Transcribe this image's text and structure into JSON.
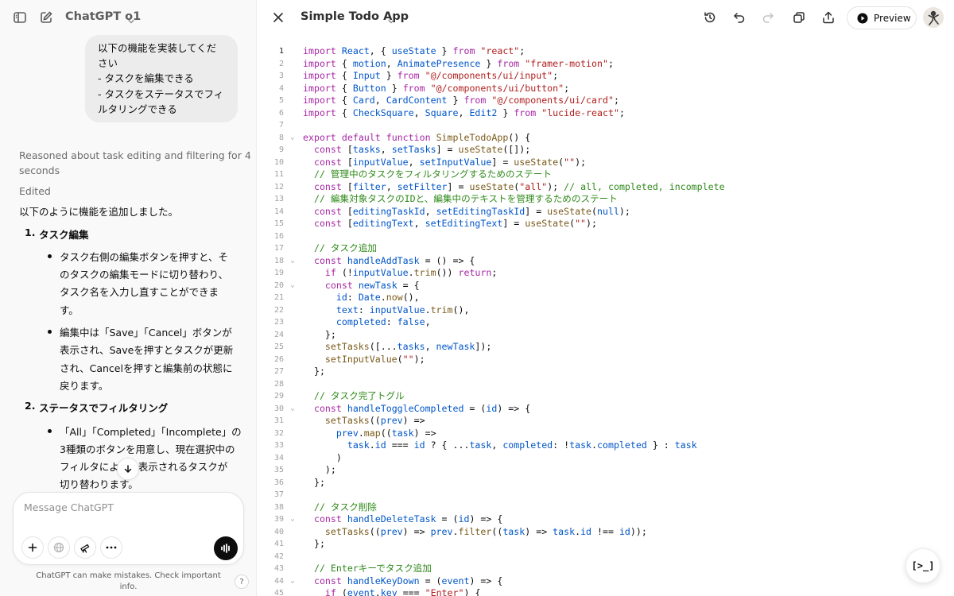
{
  "chat": {
    "model_name": "ChatGPT o1",
    "user_message": [
      "以下の機能を実装してくだ",
      "さい",
      "- タスクを編集できる",
      "- タスクをステータスでフィ",
      "ルタリングできる"
    ],
    "reasoning": [
      "Reasoned about task editing and filtering for 4",
      "seconds"
    ],
    "edited_label": "Edited",
    "intro": "以下のように機能を追加しました。",
    "sections": [
      {
        "number": "1.",
        "title": "タスク編集",
        "bullets": [
          [
            "タスク右側の編集ボタンを押すと、そ",
            "のタスクの編集モードに切り替わり、",
            "タスク名を入力し直すことができま",
            "す。"
          ],
          [
            "編集中は「Save」「Cancel」ボタンが",
            "表示され、Saveを押すとタスクが更新",
            "され、Cancelを押すと編集前の状態に",
            "戻ります。"
          ]
        ]
      },
      {
        "number": "2.",
        "title": "ステータスでフィルタリング",
        "bullets": [
          [
            "「All」「Completed」「Incomplete」の",
            "3種類のボタンを用意し、現在選択中の",
            "フィルタによって表示されるタスクが",
            "切り替わります。"
          ]
        ]
      }
    ],
    "composer_placeholder": "Message ChatGPT",
    "disclaimer": "ChatGPT can make mistakes. Check important info.",
    "help_label": "?"
  },
  "canvas": {
    "title": "Simple Todo App",
    "preview_label": "Preview",
    "fab_label": "[>_]",
    "current_line": 1,
    "code_lines": [
      "import React, { useState } from \"react\";",
      "import { motion, AnimatePresence } from \"framer-motion\";",
      "import { Input } from \"@/components/ui/input\";",
      "import { Button } from \"@/components/ui/button\";",
      "import { Card, CardContent } from \"@/components/ui/card\";",
      "import { CheckSquare, Square, Edit2 } from \"lucide-react\";",
      "",
      "export default function SimpleTodoApp() {",
      "  const [tasks, setTasks] = useState([]);",
      "  const [inputValue, setInputValue] = useState(\"\");",
      "  // 管理中のタスクをフィルタリングするためのステート",
      "  const [filter, setFilter] = useState(\"all\"); // all, completed, incomplete",
      "  // 編集対象タスクのIDと、編集中のテキストを管理するためのステート",
      "  const [editingTaskId, setEditingTaskId] = useState(null);",
      "  const [editingText, setEditingText] = useState(\"\");",
      "",
      "  // タスク追加",
      "  const handleAddTask = () => {",
      "    if (!inputValue.trim()) return;",
      "    const newTask = {",
      "      id: Date.now(),",
      "      text: inputValue.trim(),",
      "      completed: false,",
      "    };",
      "    setTasks([...tasks, newTask]);",
      "    setInputValue(\"\");",
      "  };",
      "",
      "  // タスク完了トグル",
      "  const handleToggleCompleted = (id) => {",
      "    setTasks((prev) =>",
      "      prev.map((task) =>",
      "        task.id === id ? { ...task, completed: !task.completed } : task",
      "      )",
      "    );",
      "  };",
      "",
      "  // タスク削除",
      "  const handleDeleteTask = (id) => {",
      "    setTasks((prev) => prev.filter((task) => task.id !== id));",
      "  };",
      "",
      "  // Enterキーでタスク追加",
      "  const handleKeyDown = (event) => {",
      "    if (event.key === \"Enter\") {"
    ],
    "fold_lines": [
      8,
      18,
      20,
      30,
      39,
      44
    ]
  }
}
